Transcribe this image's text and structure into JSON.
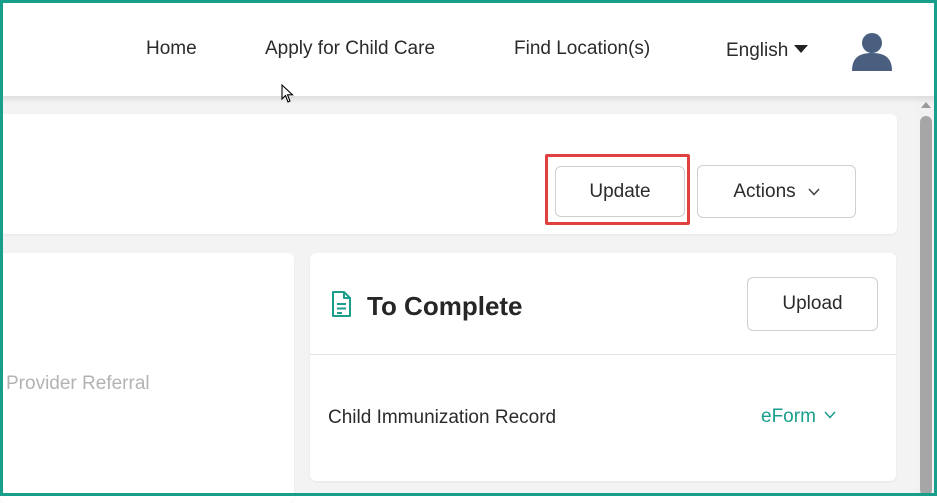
{
  "nav": {
    "home": "Home",
    "apply": "Apply for Child Care",
    "find": "Find Location(s)",
    "language": "English"
  },
  "header_card": {
    "update_label": "Update",
    "actions_label": "Actions"
  },
  "left_card": {
    "provider_referral": "Provider Referral"
  },
  "to_complete": {
    "title": "To Complete",
    "upload_label": "Upload",
    "items": [
      {
        "label": "Child Immunization Record",
        "action": "eForm"
      }
    ]
  },
  "colors": {
    "accent": "#1a9e8c",
    "highlight": "#e0413e",
    "avatar": "#4a5f80"
  },
  "icons": [
    "caret-down-icon",
    "user-avatar-icon",
    "chevron-down-icon",
    "document-icon",
    "mouse-cursor-icon"
  ]
}
